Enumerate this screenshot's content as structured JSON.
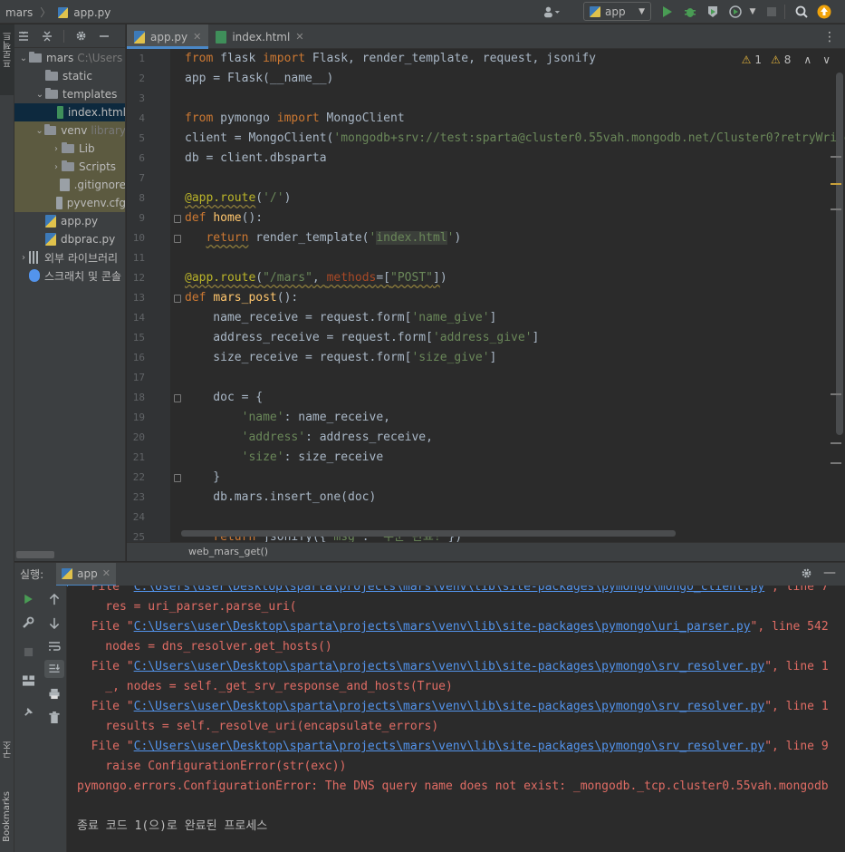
{
  "navbar": {
    "project": "mars",
    "file": "app.py",
    "run_config": "app"
  },
  "stripe": {
    "project_label": "프로젝트",
    "structure_label": "구조",
    "bookmarks_label": "Bookmarks"
  },
  "project_tree": [
    {
      "label": "mars",
      "hint": "C:\\Users",
      "type": "folder",
      "depth": 0,
      "expanded": true
    },
    {
      "label": "static",
      "type": "folder",
      "depth": 1
    },
    {
      "label": "templates",
      "type": "folder",
      "depth": 1,
      "expanded": true
    },
    {
      "label": "index.html",
      "type": "html",
      "depth": 2,
      "selected": true
    },
    {
      "label": "venv",
      "hint": "library",
      "type": "folder",
      "depth": 1,
      "expanded": true,
      "excluded": true
    },
    {
      "label": "Lib",
      "type": "folder",
      "depth": 2,
      "collapsed": true,
      "excluded": true
    },
    {
      "label": "Scripts",
      "type": "folder",
      "depth": 2,
      "collapsed": true,
      "excluded": true
    },
    {
      "label": ".gitignore",
      "type": "txt",
      "depth": 2,
      "excluded": true
    },
    {
      "label": "pyvenv.cfg",
      "type": "txt",
      "depth": 2,
      "excluded": true
    },
    {
      "label": "app.py",
      "type": "py",
      "depth": 1
    },
    {
      "label": "dbprac.py",
      "type": "py",
      "depth": 1
    },
    {
      "label": "외부 라이브러리",
      "type": "lib",
      "depth": 0,
      "collapsed": true
    },
    {
      "label": "스크래치 및 콘솔",
      "type": "scratch",
      "depth": 0
    }
  ],
  "tabs": [
    {
      "label": "app.py",
      "active": true
    },
    {
      "label": "index.html",
      "active": false
    }
  ],
  "inspections": {
    "warnings": "1",
    "weak": "8"
  },
  "code_lines": [
    "1",
    "2",
    "3",
    "4",
    "5",
    "6",
    "7",
    "8",
    "9",
    "10",
    "11",
    "12",
    "13",
    "14",
    "15",
    "16",
    "17",
    "18",
    "19",
    "20",
    "21",
    "22",
    "23",
    "24",
    "25"
  ],
  "editor_breadcrumb": "web_mars_get()",
  "run": {
    "label": "실행:",
    "tab": "app"
  },
  "console_lines": [
    {
      "prefix": "  File \"",
      "path": "C:\\Users\\user\\Desktop\\sparta\\projects\\mars\\venv\\lib\\site-packages\\pymongo\\mongo_client.py",
      "suffix": "\", line 7"
    },
    {
      "text": "    res = uri_parser.parse_uri("
    },
    {
      "prefix": "  File \"",
      "path": "C:\\Users\\user\\Desktop\\sparta\\projects\\mars\\venv\\lib\\site-packages\\pymongo\\uri_parser.py",
      "suffix": "\", line 542"
    },
    {
      "text": "    nodes = dns_resolver.get_hosts()"
    },
    {
      "prefix": "  File \"",
      "path": "C:\\Users\\user\\Desktop\\sparta\\projects\\mars\\venv\\lib\\site-packages\\pymongo\\srv_resolver.py",
      "suffix": "\", line 1"
    },
    {
      "text": "    _, nodes = self._get_srv_response_and_hosts(True)"
    },
    {
      "prefix": "  File \"",
      "path": "C:\\Users\\user\\Desktop\\sparta\\projects\\mars\\venv\\lib\\site-packages\\pymongo\\srv_resolver.py",
      "suffix": "\", line 1"
    },
    {
      "text": "    results = self._resolve_uri(encapsulate_errors)"
    },
    {
      "prefix": "  File \"",
      "path": "C:\\Users\\user\\Desktop\\sparta\\projects\\mars\\venv\\lib\\site-packages\\pymongo\\srv_resolver.py",
      "suffix": "\", line 9"
    },
    {
      "text": "    raise ConfigurationError(str(exc))"
    },
    {
      "text": "pymongo.errors.ConfigurationError: The DNS query name does not exist: _mongodb._tcp.cluster0.55vah.mongodb"
    },
    {
      "text": ""
    },
    {
      "text": "종료 코드 1(으)로 완료된 프로세스",
      "plain": true
    }
  ]
}
